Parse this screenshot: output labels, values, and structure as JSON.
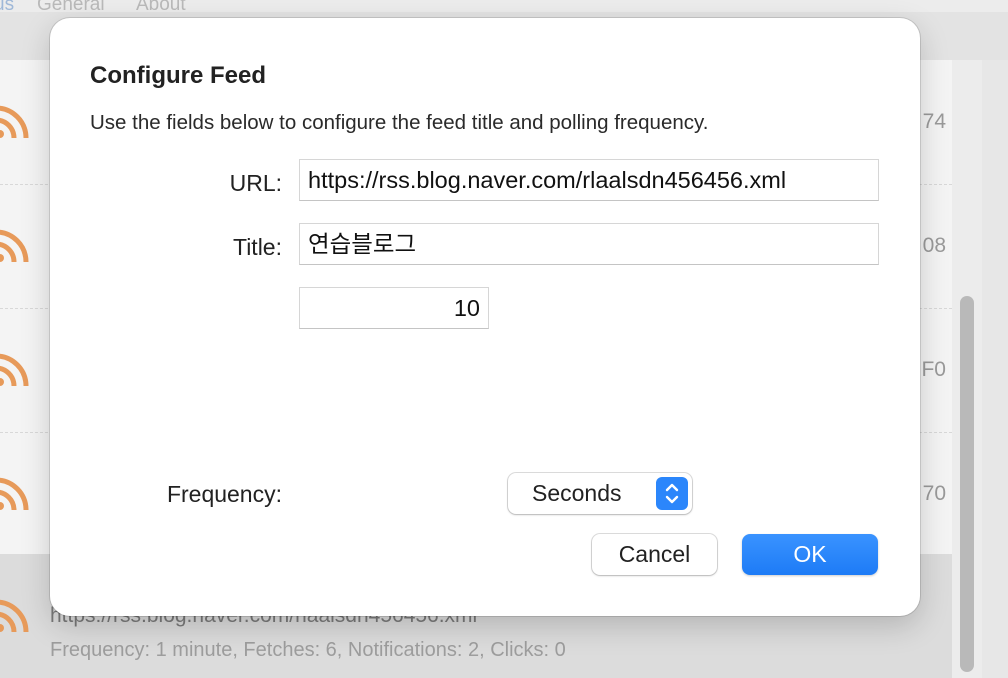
{
  "background": {
    "tabs": [
      "us",
      "General",
      "About"
    ],
    "row_values": [
      "74",
      "08",
      "F0",
      "70"
    ],
    "selected_feed": {
      "url": "https://rss.blog.naver.com/rlaalsdn456456.xml",
      "info": "Frequency: 1 minute, Fetches: 6, Notifications: 2, Clicks: 0"
    },
    "rss_icon": "rss-feed-icon",
    "rss_color": "#e79a5a"
  },
  "dialog": {
    "title": "Configure Feed",
    "description": "Use the fields below to configure the feed title and polling frequency.",
    "url_label": "URL:",
    "url_value": "https://rss.blog.naver.com/rlaalsdn456456.xml",
    "title_label": "Title:",
    "title_value": "연습블로그",
    "frequency_value": "10",
    "frequency_label": "Frequency:",
    "frequency_unit": "Seconds",
    "cancel_label": "Cancel",
    "ok_label": "OK",
    "accent_color": "#1d7bf6"
  }
}
